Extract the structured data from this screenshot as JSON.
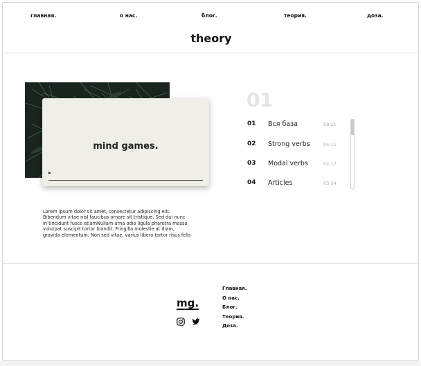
{
  "nav": {
    "items": [
      "главная.",
      "о нас.",
      "блог.",
      "теория.",
      "доза."
    ]
  },
  "page": {
    "title": "theory"
  },
  "player": {
    "title": "mind games.",
    "progress_percent": 0
  },
  "description": {
    "lines": [
      "Lorem ipsum dolor sit amet, consectetur adipiscing elit.",
      "Bibendum vitae nisl faucibus ornare sit tristique. Sed dui nunc",
      "in tincidunt fusce etiamNullam urna odio ligula pharetra massa",
      "volutpat suscipit tortor blandit. Fringilla molestie at diam,",
      "gravida elementum. Non sed vitae, varius libero tortor risus felis"
    ]
  },
  "tracklist": {
    "current_number": "01",
    "tracks": [
      {
        "number": "01",
        "title": "Вся база",
        "duration": "59:21"
      },
      {
        "number": "02",
        "title": "Strong verbs",
        "duration": "04:11"
      },
      {
        "number": "03",
        "title": "Modal verbs",
        "duration": "02:17"
      },
      {
        "number": "04",
        "title": "Articles",
        "duration": "03:54"
      }
    ]
  },
  "footer": {
    "logo": "mg.",
    "social_icons": [
      "instagram-icon",
      "twitter-icon"
    ],
    "links": [
      "Главная.",
      "О нас.",
      "Блог.",
      "Теория.",
      "Доза."
    ]
  },
  "colors": {
    "card_background": "#efeee8",
    "big_number": "#e5e5e5",
    "duration_text": "#aaaaaa"
  }
}
